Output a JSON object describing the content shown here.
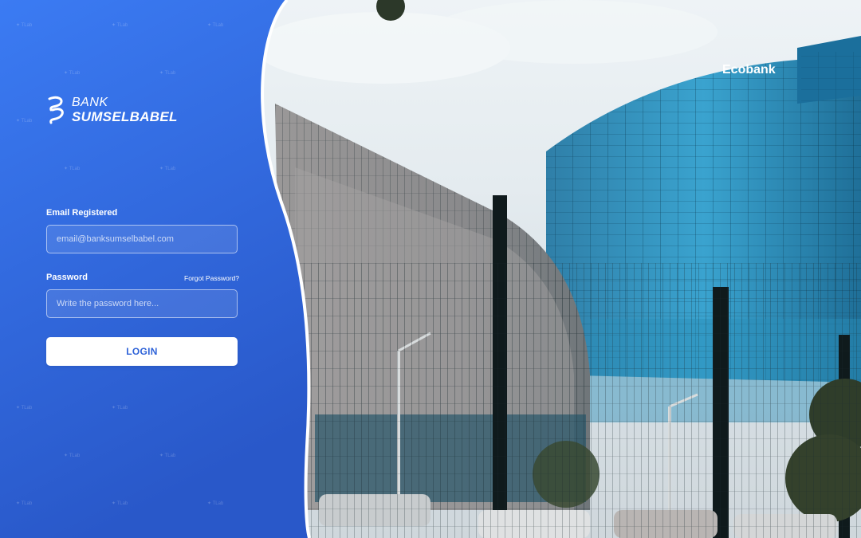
{
  "brand": {
    "line1": "BANK",
    "line2": "SUMSELBABEL"
  },
  "form": {
    "email_label": "Email Registered",
    "email_placeholder": "email@banksumselbabel.com",
    "password_label": "Password",
    "forgot_label": "Forgot Password?",
    "password_placeholder": "Write the password here...",
    "login_label": "LOGIN"
  },
  "photo": {
    "building_sign": "Ecobank"
  },
  "colors": {
    "panel_top": "#3a7af2",
    "panel_bottom": "#2a59c9",
    "button_text": "#2f63d8",
    "accent_white": "#ffffff"
  }
}
